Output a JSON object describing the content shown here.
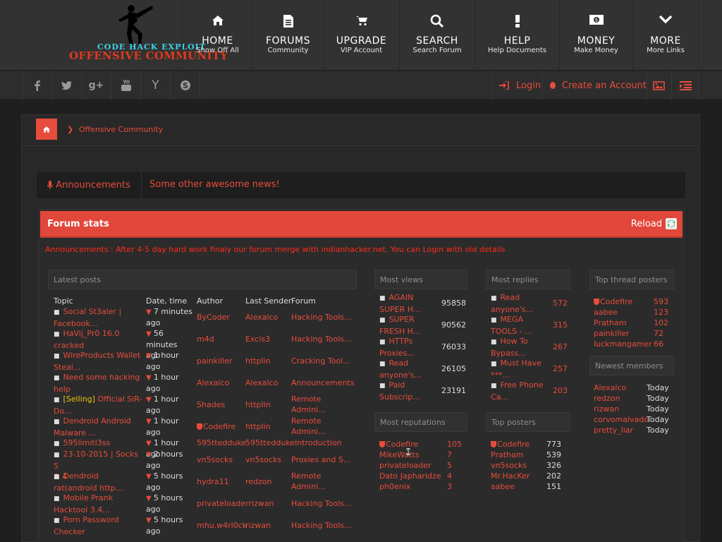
{
  "header": {
    "logo_line1": "CODE  HACK  EXPLOIT",
    "logo_line2": "OFFENSIVE COMMUNITY",
    "nav": [
      {
        "title": "HOME",
        "sub": "Show Off All",
        "icon": "home-icon"
      },
      {
        "title": "FORUMS",
        "sub": "Community",
        "icon": "document-icon"
      },
      {
        "title": "UPGRADE",
        "sub": "VIP Account",
        "icon": "cart-icon"
      },
      {
        "title": "SEARCH",
        "sub": "Search Forum",
        "icon": "search-icon"
      },
      {
        "title": "HELP",
        "sub": "Help Documents",
        "icon": "exclamation-icon"
      },
      {
        "title": "MONEY",
        "sub": "Make Money",
        "icon": "money-icon"
      },
      {
        "title": "MORE",
        "sub": "More Links",
        "icon": "chevron-down-icon"
      }
    ]
  },
  "subbar": {
    "social": [
      "facebook-icon",
      "twitter-icon",
      "google-plus-icon",
      "youtube-icon",
      "y-icon",
      "skype-icon"
    ],
    "login": "Login",
    "register": "Create an Account"
  },
  "breadcrumb": {
    "current": "Offensive Community"
  },
  "announcement": {
    "tab": "Announcements",
    "text": "Some other awesome news!"
  },
  "stats": {
    "title": "Forum stats",
    "reload": "Reload",
    "ticker": "Announcements : After 4-5 day hard work finaly our forum merge with indianhacker.net. You can Login with old details",
    "latest": {
      "header": "Latest posts",
      "columns": [
        "Topic",
        "Date, time",
        "Author",
        "Last Sender",
        "Forum"
      ],
      "rows": [
        {
          "tag": "",
          "topic1": "Social St3aler |",
          "topic2": "Facebook...",
          "time1": "7 minutes",
          "time2": "ago",
          "author": "ByCoder",
          "sender": "Alexalco",
          "forum1": "Hacking Tools...",
          "forum2": ""
        },
        {
          "tag": "",
          "topic1": "HaVij_Pr0 16.0",
          "topic2": "cracked",
          "time1": "56 minutes",
          "time2": "ago",
          "author": "m4d",
          "sender": "Excis3",
          "forum1": "Hacking Tools...",
          "forum2": ""
        },
        {
          "tag": "",
          "topic1": "WireProducts Wallet",
          "topic2": "Steal...",
          "time1": "1 hour ago",
          "time2": "",
          "author": "painkiller",
          "sender": "httplin",
          "forum1": "Cracking Tool...",
          "forum2": ""
        },
        {
          "tag": "",
          "topic1": "Need some hacking",
          "topic2": "help",
          "time1": "1 hour ago",
          "time2": "",
          "author": "Alexalco",
          "sender": "Alexalco",
          "forum1": "Announcements",
          "forum2": ""
        },
        {
          "tag": "[Selling]",
          "topic1": "Official SiR-",
          "topic2": "Do...",
          "time1": "1 hour ago",
          "time2": "",
          "author": "Shades",
          "sender": "httplin",
          "forum1": "Remote",
          "forum2": "Admini..."
        },
        {
          "tag": "",
          "topic1": "Dendroid Android",
          "topic2": "Malware ...",
          "time1": "1 hour ago",
          "time2": "",
          "author": "Codefire",
          "sender": "httplin",
          "forum1": "Remote",
          "forum2": "Admini..."
        },
        {
          "tag": "",
          "topic1": "595limitl3ss",
          "topic2": "",
          "time1": "1 hour ago",
          "time2": "",
          "author": "595ttedduke",
          "sender": "595tteddukeIntroduction",
          "forum1": "",
          "forum2": ""
        },
        {
          "tag": "",
          "topic1": "23-10-2015 | Socks 5",
          "topic2": "& 4",
          "time1": "2 hours",
          "time2": "ago",
          "author": "vn5socks",
          "sender": "vn5socks",
          "forum1": "Proxies and S...",
          "forum2": ""
        },
        {
          "tag": "",
          "topic1": "Dendroid",
          "topic2": "rat(android http...",
          "time1": "5 hours",
          "time2": "ago",
          "author": "hydra11",
          "sender": "redzon",
          "forum1": "Remote",
          "forum2": "Admini..."
        },
        {
          "tag": "",
          "topic1": "Mobile Prank",
          "topic2": "Hacktool 3.4...",
          "time1": "5 hours",
          "time2": "ago",
          "author": "privateloaderrizwan",
          "sender": "",
          "forum1": "Hacking Tools...",
          "forum2": ""
        },
        {
          "tag": "",
          "topic1": "Porn Password",
          "topic2": "Checker",
          "time1": "5 hours",
          "time2": "ago",
          "author": "mhu.w4rl0ck",
          "sender": "rizwan",
          "forum1": "Hacking Tools...",
          "forum2": ""
        }
      ]
    },
    "most_views": {
      "header": "Most views",
      "rows": [
        {
          "t1": "AGAIN",
          "t2": "SUPER H...",
          "v": "95858"
        },
        {
          "t1": "SUPER",
          "t2": "FRESH H...",
          "v": "90562"
        },
        {
          "t1": "HTTPs",
          "t2": "Proxies...",
          "v": "76033"
        },
        {
          "t1": "Read",
          "t2": "anyone's...",
          "v": "26105"
        },
        {
          "t1": "Paid",
          "t2": "Subscrip...",
          "v": "23191"
        }
      ]
    },
    "most_replies": {
      "header": "Most replies",
      "rows": [
        {
          "t1": "Read",
          "t2": "anyone's...",
          "v": "572"
        },
        {
          "t1": "MEGA",
          "t2": "TOOLS - ...",
          "v": "315"
        },
        {
          "t1": "How To",
          "t2": "Bypass...",
          "v": "267"
        },
        {
          "t1": "Must Have",
          "t2": "***...",
          "v": "257"
        },
        {
          "t1": "Free Phone",
          "t2": "Ca...",
          "v": "203"
        }
      ]
    },
    "most_reputations": {
      "header": "Most reputations",
      "rows": [
        {
          "name": "Codefire",
          "v": "105",
          "shield": true
        },
        {
          "name": "MikeWatts",
          "v": "7",
          "shield": false
        },
        {
          "name": "privateloader",
          "v": "5",
          "shield": false
        },
        {
          "name": "Dato Japharidze",
          "v": "4",
          "shield": false
        },
        {
          "name": "ph0enix",
          "v": "3",
          "shield": false
        }
      ]
    },
    "top_posters": {
      "header": "Top posters",
      "rows": [
        {
          "name": "Codefire",
          "v": "773",
          "shield": true
        },
        {
          "name": "Pratham",
          "v": "539",
          "shield": false
        },
        {
          "name": "vn5socks",
          "v": "326",
          "shield": false
        },
        {
          "name": "Mr.HacKer",
          "v": "202",
          "shield": false
        },
        {
          "name": "aabee",
          "v": "151",
          "shield": false
        }
      ]
    },
    "top_thread_posters": {
      "header": "Top thread posters",
      "rows": [
        {
          "name": "Codefire",
          "v": "593",
          "shield": true
        },
        {
          "name": "aabee",
          "v": "123",
          "shield": false
        },
        {
          "name": "Pratham",
          "v": "102",
          "shield": false
        },
        {
          "name": "painkiller",
          "v": "72",
          "shield": false
        },
        {
          "name": "luckmangamer",
          "v": "66",
          "shield": false
        }
      ]
    },
    "newest_members": {
      "header": "Newest members",
      "rows": [
        {
          "name": "Alexalco",
          "v": "Today"
        },
        {
          "name": "redzon",
          "v": "Today"
        },
        {
          "name": "rizwan",
          "v": "Today"
        },
        {
          "name": "corvomalvado",
          "v": "Today"
        },
        {
          "name": "pretty_liar",
          "v": "Today"
        }
      ]
    }
  }
}
